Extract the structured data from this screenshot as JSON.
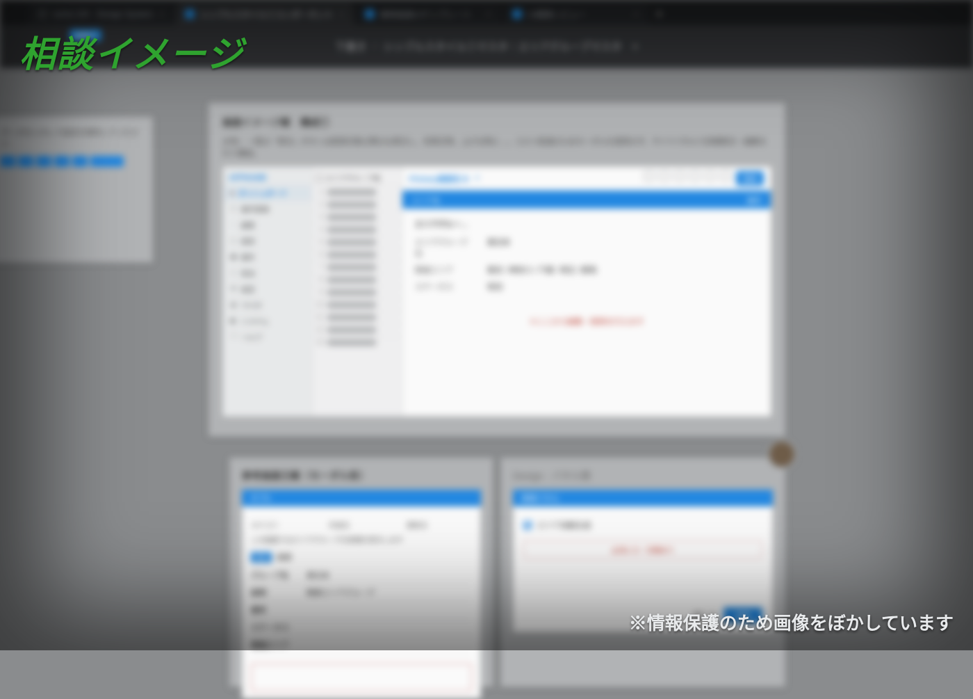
{
  "overlay": {
    "title": "相談イメージ",
    "disclaimer": "※情報保護のため画像をぼかしています"
  },
  "browser": {
    "tabs": [
      {
        "label": "some UIX · Design System",
        "active": false,
        "fav": "grey"
      },
      {
        "label": "シンプルスタイル①コンポーネント",
        "active": true,
        "fav": "blue"
      },
      {
        "label": "業務画面UIテンプレート",
        "active": false,
        "fav": "blue"
      },
      {
        "label": "UI課題レビュー",
        "active": false,
        "fav": "blue"
      }
    ],
    "badge": "編集中",
    "breadcrumb": {
      "parent": "下書き",
      "file": "シンプルスタイル①マスタ｜エリアグループマスタ",
      "sep": "/"
    }
  },
  "leftFrame": {
    "caption": "データを入力して設定を保存してください"
  },
  "centerFrame": {
    "title": "画面イメージ案　構成①",
    "memo_head": "メモ：",
    "memo": "一覧の「表示」ボタンは削除対象の際のみ表示し、非表示時、上げる時に…。コスト削減のためモーダルを使用せず、サイドパネルで詳細表示・編集を行う構成。",
    "app": {
      "brand": "APPNAME",
      "bar_title": "Primary画面名 B",
      "action_label": "登録",
      "subbar_left": "エリア名",
      "subbar_right": "操作",
      "side": [
        "ダッシュボード",
        "案件管理",
        "顧客",
        "請求",
        "案件",
        "担当",
        "設定",
        "マスタ",
        "システム",
        "ヘルプ"
      ],
      "list_header": "エリアグループ名",
      "rows_count": 13,
      "detail_title": "エリアグルー…",
      "detail": [
        {
          "k": "エリアグループ名",
          "v": "東日本"
        },
        {
          "k": "関連エリア",
          "v": "東京 / 神奈川 / 千葉 / 埼玉 / 群馬"
        },
        {
          "k": "ステータス",
          "v": "有効"
        }
      ],
      "red_note": "※ここから編集・削除を行えます"
    }
  },
  "bottomLeft": {
    "heading": "参考画面③案（モーダル系）",
    "tab_label": "タブA",
    "note": "この画面ではエリアグループの詳細を表示します",
    "toggle_badge": "有効",
    "toggle_label": "検索",
    "cols": [
      "カテゴリ",
      "作成日",
      "更新日"
    ],
    "table": [
      {
        "th": "グループ名",
        "td": "東日本"
      },
      {
        "th": "説明",
        "td": "関東エリアグループ"
      },
      {
        "th": "備考",
        "td": ""
      },
      {
        "th": "ステータス",
        "td": ""
      },
      {
        "th": "関連エリア",
        "td": ""
      }
    ]
  },
  "bottomRight": {
    "heading": "Design · パネル案",
    "tab_label": "登録パネル",
    "check_label": "エリア自動生成",
    "outlined_text": "必須入力・空欄あり",
    "close_label": "閉じる",
    "primary_label": "登録"
  }
}
